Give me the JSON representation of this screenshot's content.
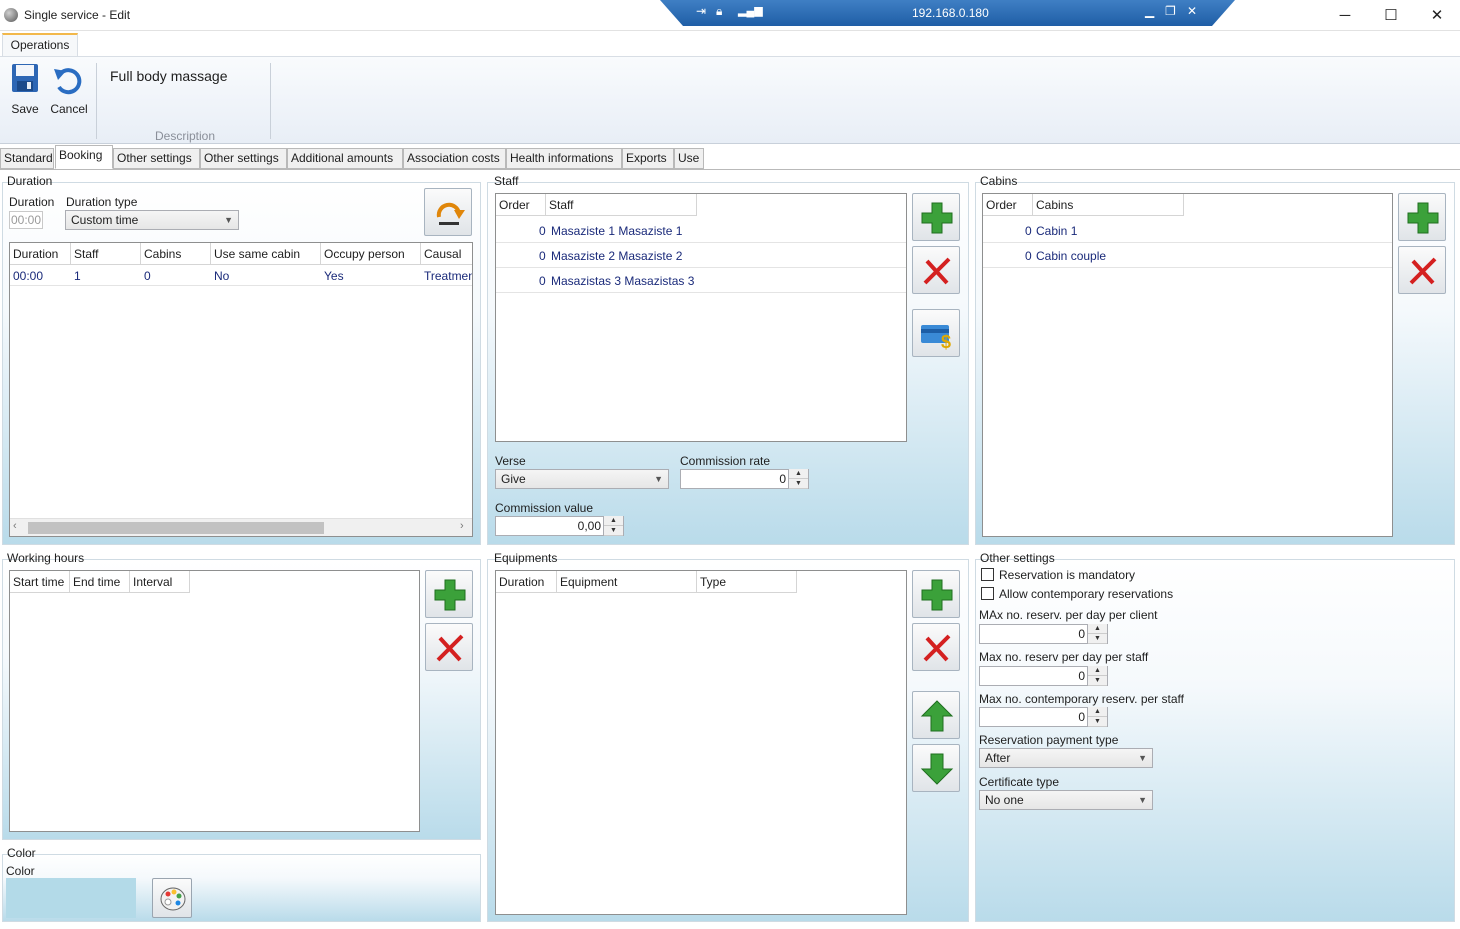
{
  "window": {
    "title": "Single service - Edit",
    "remote_host": "192.168.0.180"
  },
  "ribbon": {
    "tab_label": "Operations",
    "save_label": "Save",
    "cancel_label": "Cancel",
    "description_value": "Full body massage",
    "description_group": "Description"
  },
  "tabs": [
    {
      "label": "Standard",
      "active": false
    },
    {
      "label": "Booking",
      "active": true
    },
    {
      "label": "Other settings",
      "active": false
    },
    {
      "label": "Other settings",
      "active": false
    },
    {
      "label": "Additional amounts",
      "active": false
    },
    {
      "label": "Association costs",
      "active": false
    },
    {
      "label": "Health informations",
      "active": false
    },
    {
      "label": "Exports",
      "active": false
    },
    {
      "label": "Use",
      "active": false
    }
  ],
  "duration": {
    "group_label": "Duration",
    "duration_label": "Duration",
    "duration_value": "00:00",
    "type_label": "Duration type",
    "type_value": "Custom time",
    "columns": [
      "Duration",
      "Staff",
      "Cabins",
      "Use same cabin",
      "Occupy person",
      "Causal"
    ],
    "rows": [
      [
        "00:00",
        "1",
        "0",
        "No",
        "Yes",
        "Treatmen"
      ]
    ]
  },
  "staff": {
    "group_label": "Staff",
    "columns": [
      "Order",
      "Staff"
    ],
    "rows": [
      {
        "order": "0",
        "name": "Masaziste 1 Masaziste 1"
      },
      {
        "order": "0",
        "name": "Masaziste 2 Masaziste 2"
      },
      {
        "order": "0",
        "name": "Masazistas 3 Masazistas 3"
      }
    ],
    "verse_label": "Verse",
    "verse_value": "Give",
    "commission_rate_label": "Commission rate",
    "commission_rate_value": "0",
    "commission_value_label": "Commission value",
    "commission_value_value": "0,00"
  },
  "cabins": {
    "group_label": "Cabins",
    "columns": [
      "Order",
      "Cabins"
    ],
    "rows": [
      {
        "order": "0",
        "name": "Cabin 1"
      },
      {
        "order": "0",
        "name": "Cabin couple"
      }
    ]
  },
  "working_hours": {
    "group_label": "Working hours",
    "columns": [
      "Start time",
      "End time",
      "Interval"
    ]
  },
  "equipments": {
    "group_label": "Equipments",
    "columns": [
      "Duration",
      "Equipment",
      "Type"
    ]
  },
  "other_settings": {
    "group_label": "Other settings",
    "reservation_mandatory_label": "Reservation is mandatory",
    "reservation_mandatory_checked": false,
    "allow_contemporary_label": "Allow contemporary reservations",
    "allow_contemporary_checked": false,
    "max_per_day_client_label": "MAx no. reserv. per day per client",
    "max_per_day_client_value": "0",
    "max_per_day_staff_label": "Max no. reserv per day per staff",
    "max_per_day_staff_value": "0",
    "max_contemporary_label": "Max no. contemporary reserv. per staff",
    "max_contemporary_value": "0",
    "payment_type_label": "Reservation payment type",
    "payment_type_value": "After",
    "certificate_type_label": "Certificate type",
    "certificate_type_value": "No one"
  },
  "color": {
    "group_label": "Color",
    "color_label": "Color",
    "swatch_color": "#b3dae8"
  }
}
